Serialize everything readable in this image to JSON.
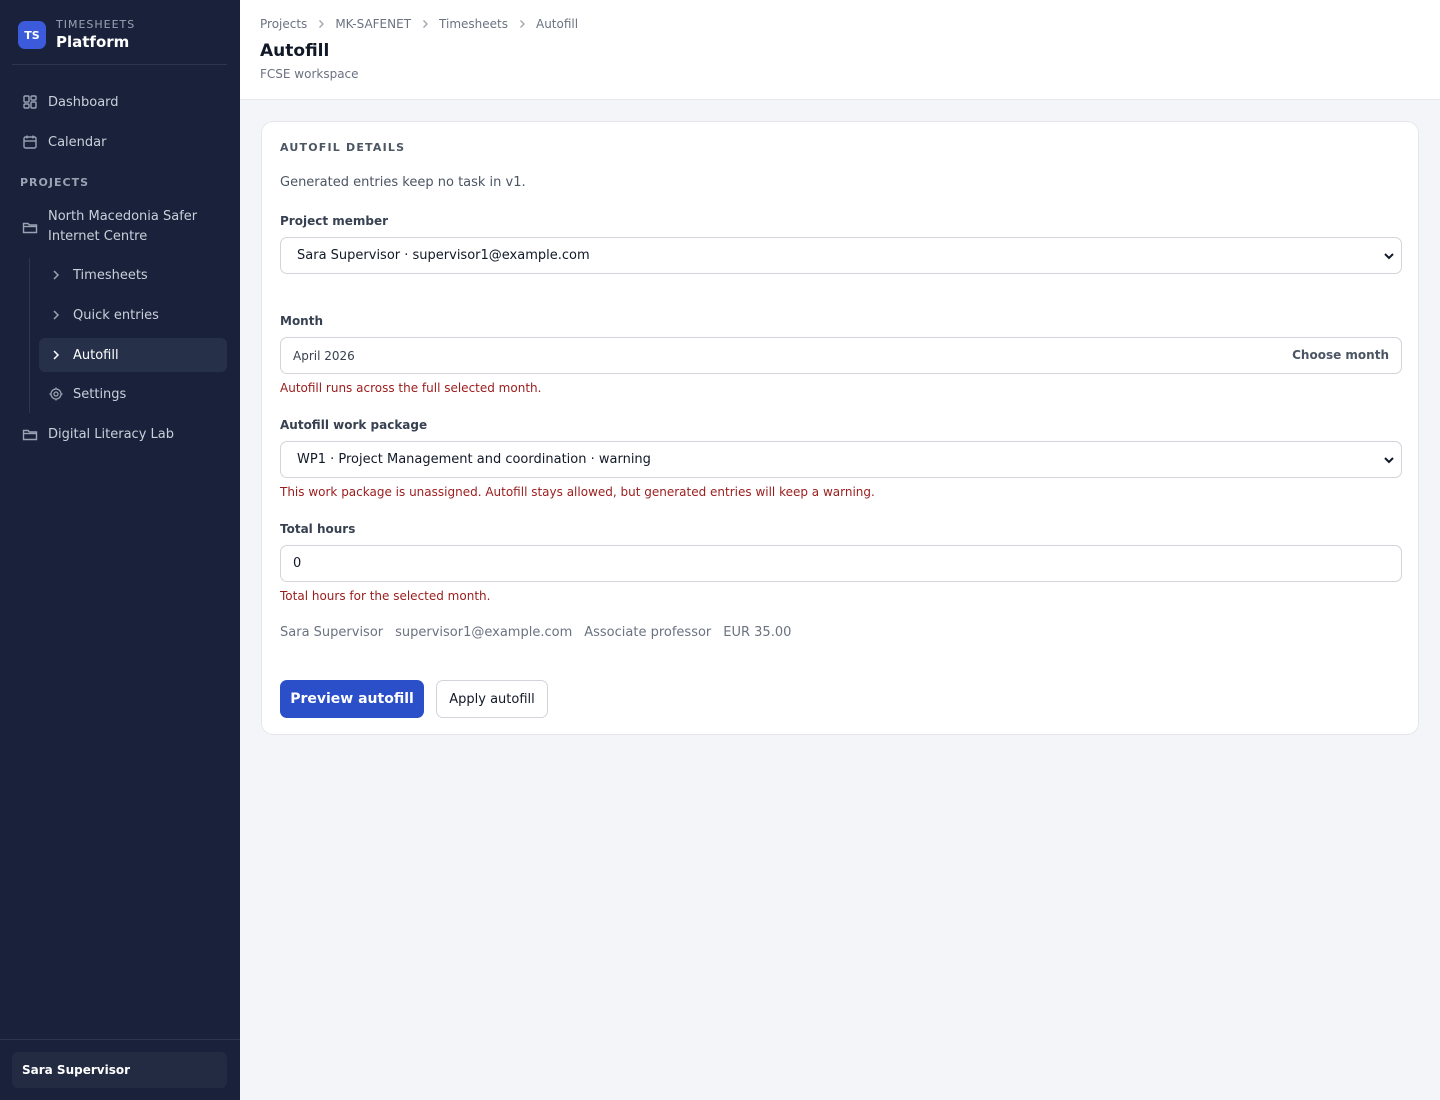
{
  "brand": {
    "badge": "TS",
    "supertitle": "TIMESHEETS",
    "title": "Platform"
  },
  "nav": {
    "dashboard": "Dashboard",
    "calendar": "Calendar",
    "section_projects": "PROJECTS",
    "project_1": "North Macedonia Safer Internet Centre",
    "sub_timesheets": "Timesheets",
    "sub_quick_entries": "Quick entries",
    "sub_autofill": "Autofill",
    "sub_settings": "Settings",
    "project_2": "Digital Literacy Lab"
  },
  "user": {
    "name": "Sara Supervisor"
  },
  "breadcrumb": [
    "Projects",
    "MK-SAFENET",
    "Timesheets",
    "Autofill"
  ],
  "header": {
    "title": "Autofill",
    "subtitle": "FCSE workspace"
  },
  "form": {
    "card_title": "AUTOFIL DETAILS",
    "note": "Generated entries keep no task in v1.",
    "member_label": "Project member",
    "member_value": "Sara Supervisor · supervisor1@example.com",
    "month_label": "Month",
    "month_value": "April 2026",
    "month_action": "Choose month",
    "month_help": "Autofill runs across the full selected month.",
    "wp_label": "Autofill work package",
    "wp_value": "WP1 · Project Management and coordination · warning",
    "wp_help": "This work package is unassigned. Autofill stays allowed, but generated entries will keep a warning.",
    "hours_label": "Total hours",
    "hours_value": "0",
    "hours_help": "Total hours for the selected month.",
    "meta": {
      "name": "Sara Supervisor",
      "email": "supervisor1@example.com",
      "role": "Associate professor",
      "rate": "EUR 35.00"
    },
    "preview_button": "Preview autofill",
    "apply_button": "Apply autofill"
  },
  "colors": {
    "sidebar_bg": "#19223a",
    "primary": "#2a4fc9",
    "error": "#9b1c1c"
  }
}
